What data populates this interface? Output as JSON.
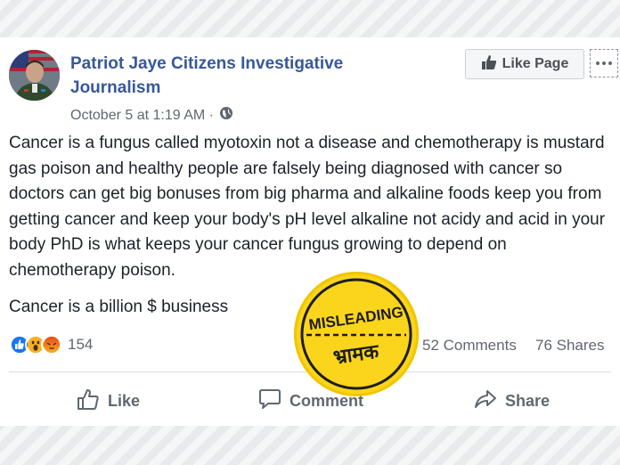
{
  "post": {
    "author": "Patriot Jaye Citizens Investigative Journalism",
    "timestamp": "October 5 at 1:19 AM ·",
    "privacy_icon": "globe-icon",
    "like_page_label": "Like Page",
    "body_paragraph_1": "Cancer is a fungus called myotoxin not a disease and chemotherapy is mustard gas poison and healthy people are falsely being diagnosed with cancer so doctors can get big bonuses from big pharma and alkaline foods keep you from getting cancer and keep your body's pH level alkaline not acidy and acid in your body PhD is what keeps your cancer fungus growing to depend on chemotherapy poison.",
    "body_paragraph_2": "Cancer is a billion $ business"
  },
  "stats": {
    "reaction_count": "154",
    "comments": "52 Comments",
    "shares": "76 Shares",
    "reaction_icons": [
      "like-reaction",
      "wow-reaction",
      "angry-reaction"
    ]
  },
  "actions": {
    "like": "Like",
    "comment": "Comment",
    "share": "Share"
  },
  "stamp": {
    "top_text": "MISLEADING",
    "bottom_text": "भ्रामक"
  },
  "colors": {
    "author_link": "#385898",
    "like_blue": "#1877f2",
    "stamp_yellow": "#fbd51b"
  }
}
